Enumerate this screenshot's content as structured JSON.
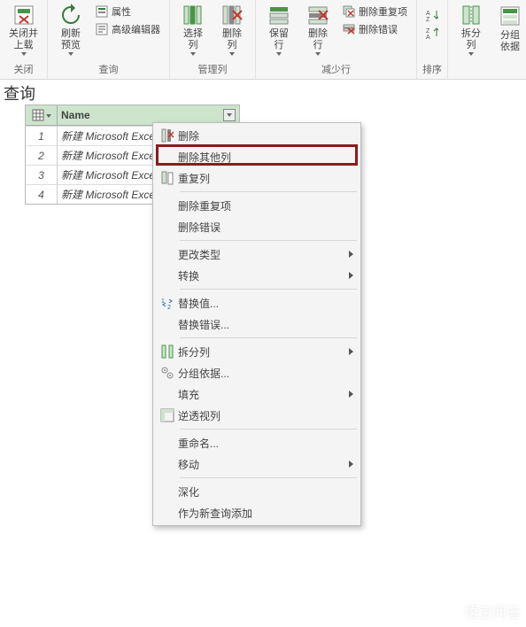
{
  "ribbon": {
    "groups": {
      "close": {
        "caption": "关闭",
        "closeLoad": "关闭并\n上载"
      },
      "query": {
        "caption": "查询",
        "refresh": "刷新\n预览",
        "props": "属性",
        "advEditor": "高级编辑器"
      },
      "manageCols": {
        "caption": "管理列",
        "choose": "选择\n列",
        "remove": "删除\n列"
      },
      "reduceRows": {
        "caption": "减少行",
        "keep": "保留\n行",
        "removeRow": "删除\n行",
        "removeDup": "删除重复项",
        "removeErr": "删除错误"
      },
      "sort": {
        "caption": "排序"
      },
      "split": {
        "splitCol": "拆分\n列",
        "groupBy": "分组\n依据"
      }
    }
  },
  "editorLabel": "查询",
  "grid": {
    "col": "Name",
    "rows": [
      {
        "n": 1,
        "v": "新建 Microsoft Excel"
      },
      {
        "n": 2,
        "v": "新建 Microsoft Excel"
      },
      {
        "n": 3,
        "v": "新建 Microsoft Excel"
      },
      {
        "n": 4,
        "v": "新建 Microsoft Excel"
      }
    ]
  },
  "ctx": {
    "remove": "删除",
    "removeOther": "删除其他列",
    "dup": "重复列",
    "removeDup": "删除重复项",
    "removeErr": "删除错误",
    "changeType": "更改类型",
    "transform": "转换",
    "replaceVal": "替换值...",
    "replaceErr": "替换错误...",
    "splitCol": "拆分列",
    "groupBy": "分组依据...",
    "fill": "填充",
    "unpivot": "逆透视列",
    "rename": "重命名...",
    "move": "移动",
    "drill": "深化",
    "addAsQuery": "作为新查询添加"
  },
  "watermark": "悟空问答"
}
